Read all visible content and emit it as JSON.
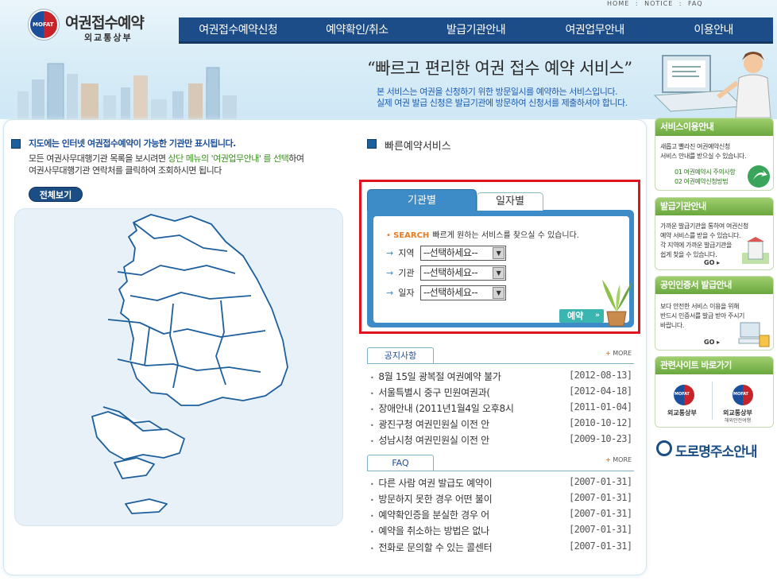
{
  "header": {
    "logo_emblem_text": "MOFAT",
    "logo_title": "여권접수예약",
    "logo_sub": "외교통상부",
    "util_links": [
      "HOME",
      "NOTICE",
      "FAQ"
    ],
    "util_sep": ":",
    "nav": [
      "여권접수예약신청",
      "예약확인/취소",
      "발급기관안내",
      "여권업무안내",
      "이용안내"
    ],
    "slogan": "“빠르고 편리한 여권 접수 예약 서비스”",
    "intro_line1": "본 서비스는 여권을 신청하기 위한 방문일시를 예약하는 서비스입니다.",
    "intro_line2": "실제 여권 발급 신청은 발급기관에 방문하여 신청서를 제출하셔야 합니다."
  },
  "map_section": {
    "title": "지도에는 인터넷 여권접수예약이 가능한 기관만 표시됩니다.",
    "desc1_prefix": "모든 여권사무대행기관 목록을 보시려면 ",
    "desc1_highlight": "상단 메뉴의 '여권업무안내' 를 선택",
    "desc1_suffix": "하여",
    "desc2": "여권사무대행기관 연락처를 클릭하여 조회하시면 됩니다",
    "view_all": "전체보기"
  },
  "quick": {
    "title": "빠른예약서비스",
    "tab_org": "기관별",
    "tab_date": "일자별",
    "search_dot": "•",
    "search_keyword": "SEARCH",
    "search_desc": "빠르게 원하는 서비스를 찾으실 수 있습니다.",
    "arrow": "→",
    "fields": [
      {
        "label": "지역",
        "value": "--선택하세요--"
      },
      {
        "label": "기관",
        "value": "--선택하세요--"
      },
      {
        "label": "일자",
        "value": "--선택하세요--"
      }
    ],
    "caret": "▼",
    "reserve_button": "예약",
    "reserve_chev": "»",
    "frame_color": "#e0141e"
  },
  "notice": {
    "tab": "공지사항",
    "more_plus": "+",
    "more": "MORE",
    "bullet": "•",
    "rows": [
      {
        "title": "8월 15일 광복절 여권예약 불가",
        "date": "[2012-08-13]"
      },
      {
        "title": "서울특별시 중구 민원여권과(",
        "date": "[2012-04-18]"
      },
      {
        "title": "장애안내 (2011년1월4일 오후8시",
        "date": "[2011-01-04]"
      },
      {
        "title": "광진구청 여권민원실 이전 안",
        "date": "[2010-10-12]"
      },
      {
        "title": "성남시청 여권민원실 이전 안",
        "date": "[2009-10-23]"
      }
    ]
  },
  "faq": {
    "tab": "FAQ",
    "more_plus": "+",
    "more": "MORE",
    "bullet": "•",
    "rows": [
      {
        "title": "다른 사람 여권 발급도 예약이",
        "date": "[2007-01-31]"
      },
      {
        "title": "방문하지 못한 경우 어떤 불이",
        "date": "[2007-01-31]"
      },
      {
        "title": "예약확인증을 분실한 경우 어",
        "date": "[2007-01-31]"
      },
      {
        "title": "예약을 취소하는 방법은 없나",
        "date": "[2007-01-31]"
      },
      {
        "title": "전화로 문의할 수 있는 콜센터",
        "date": "[2007-01-31]"
      }
    ]
  },
  "sidebar": {
    "service": {
      "head": "서비스이용안내",
      "text1": "새롭고 빨라진 여권예약신청",
      "text2": "서비스 안내를 받으실 수 있습니다.",
      "items": [
        "01  여권예약시 주의사항",
        "02  여권예약신청방법"
      ]
    },
    "issuer": {
      "head": "발급기관안내",
      "lines": [
        "가까운 발급기관을 통하여 여권신청",
        "예약 서비스를 받을 수 있습니다.",
        "각 지역에 가까운 발급기관을",
        "쉽게 찾을 수 있습니다."
      ],
      "go": "GO"
    },
    "cert": {
      "head": "공인인증서 발급안내",
      "lines": [
        "보다 안전한 서비스 이용을 위해",
        "반드시 인증서를 발급 받아 주시기",
        "바랍니다."
      ],
      "go": "GO"
    },
    "related": {
      "head": "관련사이트 바로가기",
      "logo1_emblem": "MOFAT",
      "logo1_text": "외교통상부",
      "logo2_emblem": "MOFAT",
      "logo2_text": "외교통상부",
      "logo2_sub": "해외안전여행"
    },
    "road": "도로명주소안내"
  }
}
